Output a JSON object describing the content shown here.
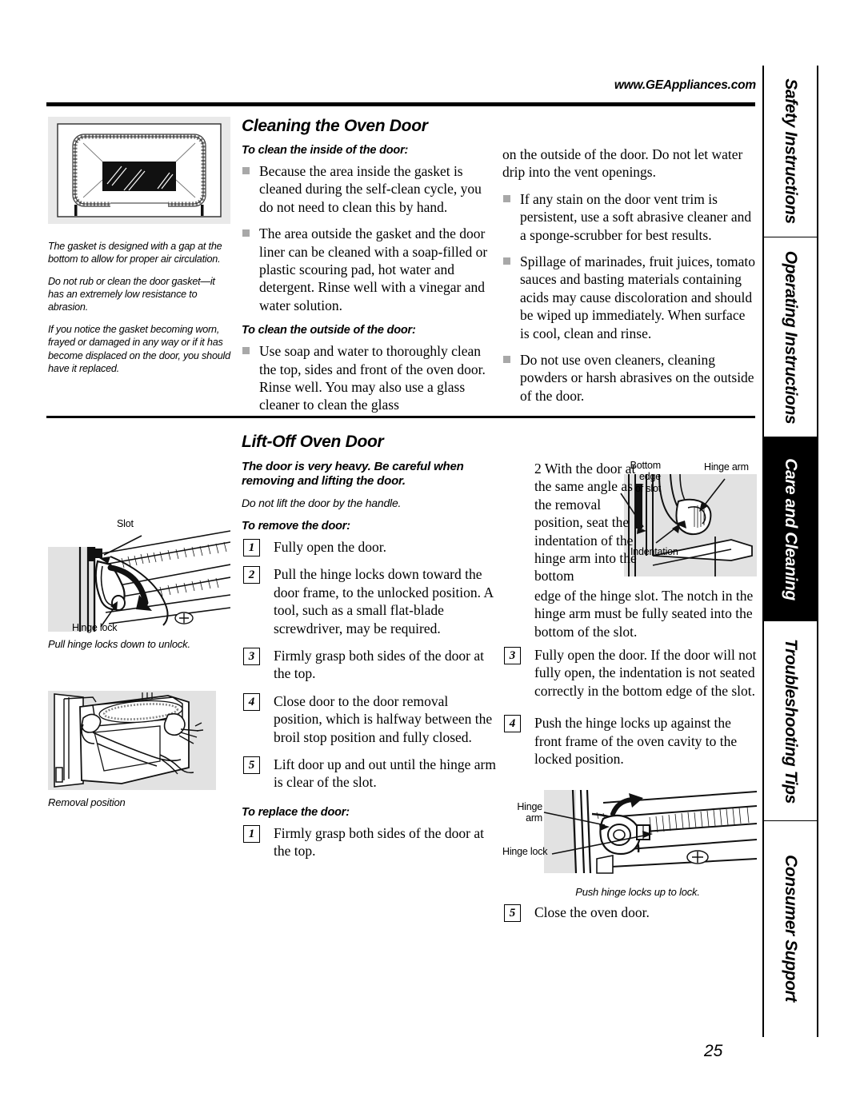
{
  "header": {
    "url": "www.GEAppliances.com"
  },
  "page_number": "25",
  "sidebar": {
    "tabs": [
      {
        "label": "Safety Instructions",
        "active": false
      },
      {
        "label": "Operating Instructions",
        "active": false
      },
      {
        "label": "Care and Cleaning",
        "active": true
      },
      {
        "label": "Troubleshooting Tips",
        "active": false
      },
      {
        "label": "Consumer Support",
        "active": false
      }
    ]
  },
  "cleaning_section": {
    "title": "Cleaning the Oven Door",
    "inside_heading": "To clean the inside of the door:",
    "inside_bullets": [
      "Because the area inside the gasket is cleaned during the self-clean cycle, you do not need to clean this by hand.",
      "The area outside the gasket and the door liner can be cleaned with a soap-filled or plastic scouring pad, hot water and detergent. Rinse well with a vinegar and water solution."
    ],
    "outside_heading": "To clean the outside of the door:",
    "outside_bullets": [
      "Use soap and water to thoroughly clean the top, sides and front of the oven door. Rinse well. You may also use a glass cleaner to clean the glass"
    ],
    "right_continuation": "on the outside of the door. Do not let water drip into the vent openings.",
    "right_bullets": [
      "If any stain on the door vent trim is persistent, use a soft abrasive cleaner and a sponge-scrubber for best results.",
      "Spillage of marinades, fruit juices, tomato sauces and basting materials containing acids may cause discoloration and should be wiped up immediately. When surface is cool, clean and rinse.",
      "Do not use oven cleaners, cleaning powders or harsh abrasives on the outside of the door."
    ],
    "gasket_notes": [
      "The gasket is designed with a gap at the bottom to allow for proper air circulation.",
      "Do not rub or clean the door gasket—it has an extremely low resistance to abrasion.",
      "If you notice the gasket becoming worn, frayed or damaged in any way or if it has become displaced on the door, you should have it replaced."
    ]
  },
  "liftoff_section": {
    "title": "Lift-Off Oven Door",
    "warning": "The door is very heavy. Be careful when removing and lifting the door.",
    "note": "Do not lift the door by the handle.",
    "remove_heading": "To remove the door:",
    "remove_steps": [
      {
        "num": "1",
        "text": "Fully open the door."
      },
      {
        "num": "2",
        "text": "Pull the hinge locks down toward the door frame, to the unlocked position. A tool, such as a small flat-blade screwdriver, may be required."
      },
      {
        "num": "3",
        "text": "Firmly grasp both sides of the door at the top."
      },
      {
        "num": "4",
        "text": "Close door to the door removal position, which is halfway between the broil stop position and fully closed."
      },
      {
        "num": "5",
        "text": "Lift door up and out until the hinge arm is clear of the slot."
      }
    ],
    "replace_heading": "To replace the door:",
    "replace_steps_mid": [
      {
        "num": "1",
        "text": "Firmly grasp both sides of the door at the top."
      }
    ],
    "replace_step2": {
      "num": "2",
      "text_wrap": "With the door at the same angle as the removal position, seat the indentation of the hinge arm into the bottom",
      "text_full": "edge of the hinge slot. The notch in the hinge arm must be fully seated into the bottom of the slot."
    },
    "replace_steps_right": [
      {
        "num": "3",
        "text": "Fully open the door. If the door will not fully open, the indentation is not seated correctly in the bottom edge of the slot."
      },
      {
        "num": "4",
        "text": "Push the hinge locks up against the front frame of the oven cavity to the locked position."
      },
      {
        "num": "5",
        "text": "Close the oven door."
      }
    ]
  },
  "figures": {
    "oven_door_gasket": {
      "caption": ""
    },
    "hinge_unlock": {
      "label_slot": "Slot",
      "label_hinge_lock": "Hinge lock",
      "caption": "Pull hinge locks down to unlock."
    },
    "removal_position": {
      "caption": "Removal position"
    },
    "hinge_seat": {
      "label_bottom_edge": "Bottom\nedge\nof slot",
      "label_bottom_edge_l1": "Bottom",
      "label_bottom_edge_l2": "edge",
      "label_bottom_edge_l3": "of slot",
      "label_hinge_arm": "Hinge arm",
      "label_indentation": "Indentation"
    },
    "hinge_lock_up": {
      "label_hinge_l1": "Hinge",
      "label_hinge_l2": "arm",
      "label_hinge_lock": "Hinge lock",
      "caption": "Push hinge locks up to lock."
    }
  }
}
